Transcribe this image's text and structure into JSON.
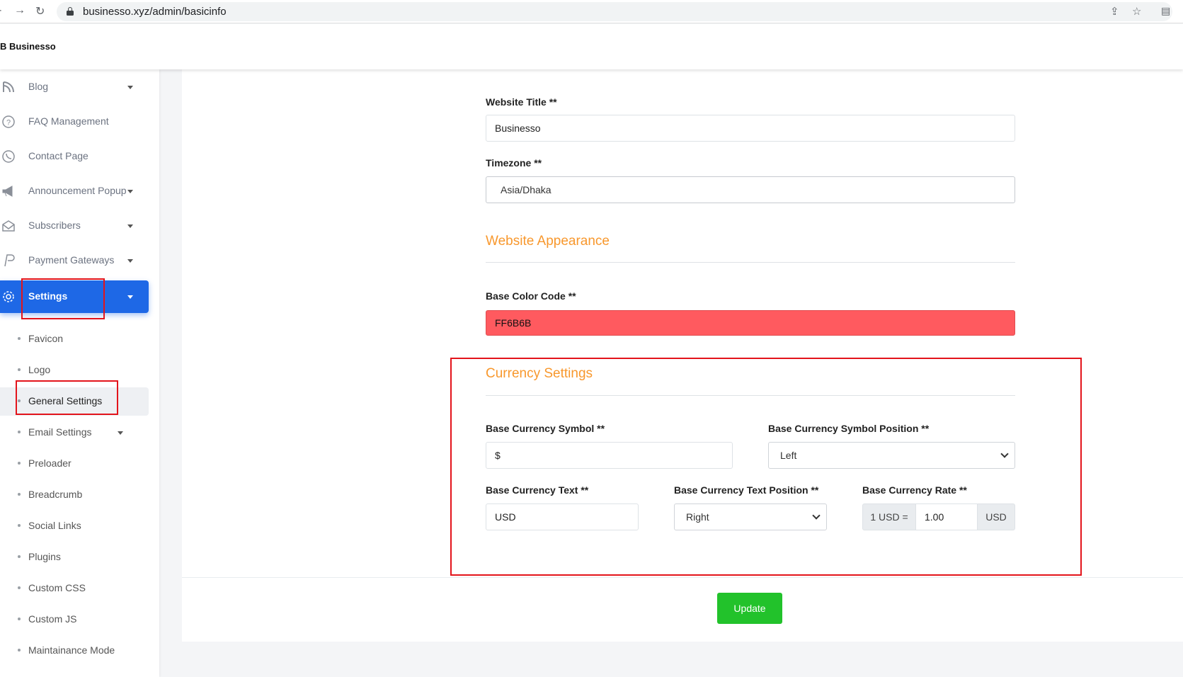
{
  "browser": {
    "url": "businesso.xyz/admin/basicinfo"
  },
  "app": {
    "logo_text": "B Businesso"
  },
  "sidebar": {
    "items": [
      {
        "label": "Blog",
        "icon": "blog-icon",
        "has_caret": true
      },
      {
        "label": "FAQ Management",
        "icon": "question-circle-icon",
        "has_caret": false
      },
      {
        "label": "Contact Page",
        "icon": "whatsapp-icon",
        "has_caret": false
      },
      {
        "label": "Announcement Popup",
        "icon": "bullhorn-icon",
        "has_caret": true
      },
      {
        "label": "Subscribers",
        "icon": "envelope-open-icon",
        "has_caret": true
      },
      {
        "label": "Payment Gateways",
        "icon": "paypal-icon",
        "has_caret": true
      },
      {
        "label": "Settings",
        "icon": "gear-icon",
        "has_caret": true,
        "active": true
      }
    ],
    "sub_items": [
      {
        "label": "Favicon"
      },
      {
        "label": "Logo"
      },
      {
        "label": "General Settings",
        "current": true
      },
      {
        "label": "Email Settings",
        "has_caret": true
      },
      {
        "label": "Preloader"
      },
      {
        "label": "Breadcrumb"
      },
      {
        "label": "Social Links"
      },
      {
        "label": "Plugins"
      },
      {
        "label": "Custom CSS"
      },
      {
        "label": "Custom JS"
      },
      {
        "label": "Maintainance Mode"
      }
    ]
  },
  "form": {
    "website_title": {
      "label": "Website Title **",
      "value": "Businesso"
    },
    "timezone": {
      "label": "Timezone **",
      "value": "Asia/Dhaka"
    },
    "appearance_heading": "Website Appearance",
    "base_color": {
      "label": "Base Color Code **",
      "value": "FF6B6B",
      "swatch": "#ff5a5f"
    },
    "currency_heading": "Currency Settings",
    "currency_symbol": {
      "label": "Base Currency Symbol **",
      "value": "$"
    },
    "currency_symbol_position": {
      "label": "Base Currency Symbol Position **",
      "value": "Left"
    },
    "currency_text": {
      "label": "Base Currency Text **",
      "value": "USD"
    },
    "currency_text_position": {
      "label": "Base Currency Text Position **",
      "value": "Right"
    },
    "currency_rate": {
      "label": "Base Currency Rate **",
      "prefix": "1 USD =",
      "value": "1.00",
      "suffix": "USD"
    },
    "update_label": "Update"
  },
  "colors": {
    "accent_orange": "#f8982d",
    "active_blue": "#1e68e6",
    "update_green": "#22c22b",
    "highlight_red": "#e3141b"
  }
}
